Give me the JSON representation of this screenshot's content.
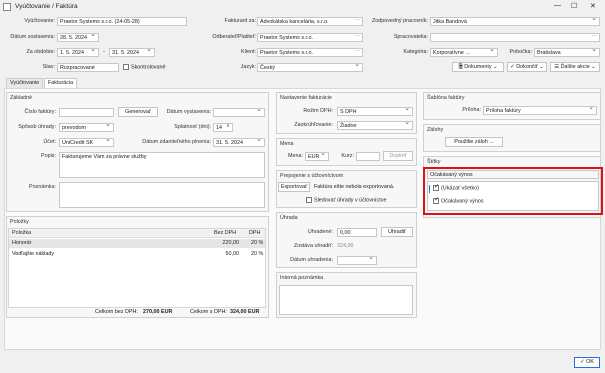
{
  "window": {
    "title": "Vyúčtovanie / Faktúra"
  },
  "header": {
    "vyuctovanie_label": "Vyúčtovanie:",
    "vyuctovanie_value": "Praetor Systems s.r.o. (24-05-28)",
    "datum_zost_label": "Dátum zostavenia:",
    "datum_zost_value": "28. 5. 2024",
    "obdobie_label": "Za obdobie:",
    "obdobie_from": "1. 5. 2024",
    "obdobie_sep": "-",
    "obdobie_to": "31. 5. 2024",
    "stav_label": "Stav:",
    "stav_value": "Rozpracované",
    "skontrolovane_label": "Skontrolované",
    "fakturant_label": "Fakturant za:",
    "fakturant_value": "Advokátska kancelária, s.r.o.",
    "odberatel_label": "Odberateľ/Platiteľ:",
    "odberatel_value": "Praetor Systems s.r.o.",
    "klient_label": "Klient:",
    "klient_value": "Praetor Systems s.r.o.",
    "jazyk_label": "Jazyk:",
    "jazyk_value": "Český",
    "zodp_label": "Zodpovedný pracovník:",
    "zodp_value": "Jitka Bandová",
    "spracovatelia_label": "Spracovatelia:",
    "kategoria_label": "Kategória:",
    "kategoria_value": "Korporatívne ...",
    "pobocka_label": "Pobočka:",
    "pobocka_value": "Bratislava",
    "dokumenty_btn": "Dokumenty",
    "dokoncit_btn": "Dokončiť",
    "dalsie_btn": "Ďalšie akcie"
  },
  "tabs": [
    "Vyúčtovanie",
    "Fakturácia"
  ],
  "zaklady": {
    "title": "Základné",
    "cislo_label": "Číslo faktúry:",
    "generovat_btn": "Generovať",
    "datum_vyst_label": "Dátum vystavenia:",
    "sposob_label": "Spôsob úhrady:",
    "sposob_value": "prevodom",
    "splatnost_label": "Splatnosť (dni):",
    "splatnost_value": "14",
    "ucet_label": "Účet:",
    "ucet_value": "UniCredit SK",
    "datum_zdan_label": "Dátum zdaniteľného plnenia:",
    "datum_zdan_value": "31. 5. 2024",
    "popis_label": "Popis:",
    "popis_value": "Fakturujeme Vám za právne služby",
    "poznamka_label": "Poznámka:"
  },
  "polozky": {
    "title": "Položky",
    "headers": [
      "Položka",
      "Bez DPH",
      "DPH"
    ],
    "rows": [
      {
        "name": "Honorár",
        "bez": "220,00",
        "dph": "20 %"
      },
      {
        "name": "Vedľajšie náklady",
        "bez": "50,00",
        "dph": "20 %"
      }
    ],
    "celkom_bez_label": "Celkom bez DPH:",
    "celkom_bez_value": "270,00 EUR",
    "celkom_s_label": "Celkom s DPH:",
    "celkom_s_value": "324,00 EUR"
  },
  "nastavenie": {
    "title": "Nastavenie fakturácie",
    "rezim_label": "Režim DPH:",
    "rezim_value": "S DPH",
    "zaokr_label": "Zaokrúhľovanie:",
    "zaokr_value": "Žiadne"
  },
  "mena": {
    "title": "Mena",
    "mena_label": "Mena:",
    "mena_value": "EUR",
    "kurz_label": "Kurz:",
    "doplnit_btn": "Doplniť"
  },
  "prepojenie": {
    "title": "Prepojenie s účtovníctvom",
    "exportovat_btn": "Exportovať",
    "status_text": "Faktúra ešte nebola exportovaná.",
    "sledovat_label": "Sledovať úhrady v účtovníctve"
  },
  "uhrada": {
    "title": "Úhrada",
    "uhradene_label": "Uhradené:",
    "uhradene_value": "0,00",
    "uhradit_btn": "Uhradiť",
    "zostava_label": "Zostáva uhradiť:",
    "zostava_value": "324,00",
    "datum_label": "Dátum uhradenia:"
  },
  "interna": {
    "title": "Interná poznámka"
  },
  "sablona": {
    "title": "Šablóna faktúry",
    "priloha_label": "Príloha:",
    "priloha_value": "Príloha faktúry"
  },
  "zalohy": {
    "title": "Zálohy",
    "pouzitie_btn": "Použitie záloh ..."
  },
  "stitky": {
    "title": "Štítky",
    "select_value": "Očakávaný výnos",
    "options": [
      {
        "label": "(Ukázať všetko)",
        "checked": true
      },
      {
        "label": "Očakávaný výnos",
        "checked": true
      }
    ]
  },
  "footer": {
    "ok_btn": "OK"
  },
  "colors": {
    "highlight": "#e0101a",
    "focus": "#2a6fd6"
  }
}
